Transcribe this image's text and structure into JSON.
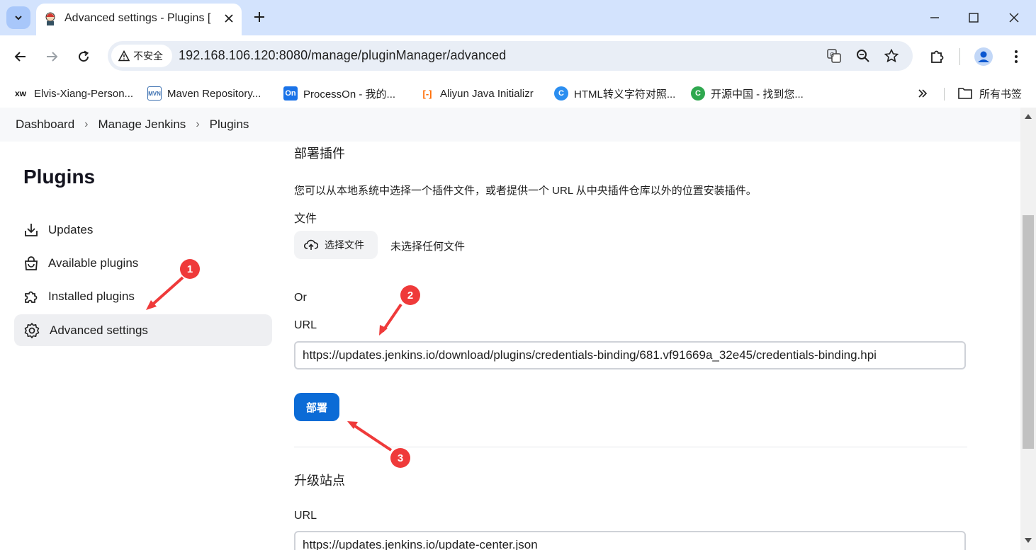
{
  "browser": {
    "tab_title": "Advanced settings - Plugins [",
    "security_label": "不安全",
    "url": "192.168.106.120:8080/manage/pluginManager/advanced",
    "bookmarks": [
      {
        "label": "Elvis-Xiang-Person...",
        "icon": "xw-icon"
      },
      {
        "label": "Maven Repository...",
        "icon": "mvn-icon"
      },
      {
        "label": "ProcessOn - 我的...",
        "icon": "on-icon"
      },
      {
        "label": "Aliyun Java Initializr",
        "icon": "aliyun-icon"
      },
      {
        "label": "HTML转义字符对照...",
        "icon": "c-blue-icon"
      },
      {
        "label": "开源中国 - 找到您...",
        "icon": "c-green-icon"
      }
    ],
    "all_bookmarks_label": "所有书签"
  },
  "breadcrumb": {
    "items": [
      "Dashboard",
      "Manage Jenkins",
      "Plugins"
    ]
  },
  "sidebar": {
    "title": "Plugins",
    "items": [
      {
        "label": "Updates",
        "icon": "download-icon"
      },
      {
        "label": "Available plugins",
        "icon": "shopping-bag-icon"
      },
      {
        "label": "Installed plugins",
        "icon": "puzzle-icon"
      },
      {
        "label": "Advanced settings",
        "icon": "gear-icon",
        "active": true
      }
    ]
  },
  "deploy": {
    "heading": "部署插件",
    "description": "您可以从本地系统中选择一个插件文件，或者提供一个 URL 从中央插件仓库以外的位置安装插件。",
    "file_label": "文件",
    "choose_file_label": "选择文件",
    "no_file_text": "未选择任何文件",
    "or_label": "Or",
    "url_label": "URL",
    "url_value": "https://updates.jenkins.io/download/plugins/credentials-binding/681.vf91669a_32e45/credentials-binding.hpi",
    "deploy_button": "部署"
  },
  "update_site": {
    "heading": "升级站点",
    "url_label": "URL",
    "url_value": "https://updates.jenkins.io/update-center.json"
  },
  "annotations": {
    "badges": [
      "1",
      "2",
      "3"
    ],
    "color": "#ef3a3a"
  },
  "colors": {
    "accent": "#0b6bd6",
    "chrome": "#d3e3fd"
  }
}
